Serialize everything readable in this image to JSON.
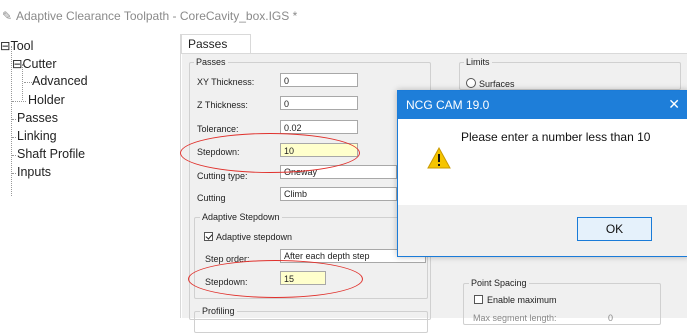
{
  "window": {
    "title": "Adaptive Clearance Toolpath - CoreCavity_box.IGS *"
  },
  "tree": {
    "items": [
      {
        "label": "Tool",
        "prefix": "⊟"
      },
      {
        "label": "Cutter",
        "prefix": "⊟"
      },
      {
        "label": "Advanced",
        "prefix": ""
      },
      {
        "label": "Holder",
        "prefix": ""
      },
      {
        "label": "Passes",
        "prefix": ""
      },
      {
        "label": "Linking",
        "prefix": ""
      },
      {
        "label": "Shaft Profile",
        "prefix": ""
      },
      {
        "label": "Inputs",
        "prefix": ""
      }
    ]
  },
  "tabs": [
    {
      "label": "Passes"
    }
  ],
  "passes_group": {
    "title": "Passes",
    "xy_thickness": {
      "label": "XY Thickness:",
      "value": "0"
    },
    "z_thickness": {
      "label": "Z Thickness:",
      "value": "0"
    },
    "tolerance": {
      "label": "Tolerance:",
      "value": "0.02"
    },
    "stepdown": {
      "label": "Stepdown:",
      "value": "10"
    },
    "cutting_type": {
      "label": "Cutting type:",
      "value": "Oneway"
    },
    "cutting": {
      "label": "Cutting",
      "value": "Climb"
    }
  },
  "adaptive_group": {
    "title": "Adaptive Stepdown",
    "checkbox_label": "Adaptive stepdown",
    "checked": true,
    "step_order": {
      "label": "Step order:",
      "value": "After each depth step"
    },
    "stepdown": {
      "label": "Stepdown:",
      "value": "15"
    }
  },
  "profiling_group": {
    "title": "Profiling"
  },
  "limits_group": {
    "title": "Limits",
    "surfaces_label": "Surfaces"
  },
  "point_spacing_group": {
    "title": "Point Spacing",
    "enable_max_label": "Enable maximum",
    "max_segment_label": "Max segment length:",
    "max_segment_value": "0"
  },
  "dialog": {
    "title": "NCG CAM 19.0",
    "close_glyph": "✕",
    "warning_glyph": "!",
    "message": "Please enter a number less than 10",
    "ok_label": "OK"
  },
  "colors": {
    "dialog_header": "#1e7ed9",
    "highlight_field": "#ffffcc",
    "annotation_red": "#e0312c",
    "warning_yellow": "#f5c400"
  }
}
